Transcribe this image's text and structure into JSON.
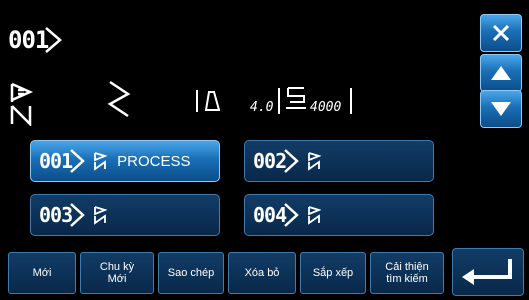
{
  "header": {
    "current_pattern": "001"
  },
  "status": {
    "tension_value": "4.0",
    "speed_value": "4000"
  },
  "programs": [
    {
      "number": "001",
      "name": "PROCESS",
      "selected": true
    },
    {
      "number": "002",
      "name": "",
      "selected": false
    },
    {
      "number": "003",
      "name": "",
      "selected": false
    },
    {
      "number": "004",
      "name": "",
      "selected": false
    }
  ],
  "side_controls": {
    "close_icon": "close-icon",
    "up_icon": "triangle-up-icon",
    "down_icon": "triangle-down-icon"
  },
  "bottom_bar": {
    "new_label": "Mới",
    "new_cycle_label_1": "Chu kỳ",
    "new_cycle_label_2": "Mới",
    "copy_label": "Sao chép",
    "delete_label": "Xóa bỏ",
    "sort_label": "Sắp xếp",
    "improve_search_label_1": "Cải thiện",
    "improve_search_label_2": "tìm kiếm",
    "enter_icon": "enter-icon"
  },
  "colors": {
    "selected_button": "#2a86d0",
    "button": "#0e3560",
    "background": "#000000",
    "text": "#ffffff"
  }
}
